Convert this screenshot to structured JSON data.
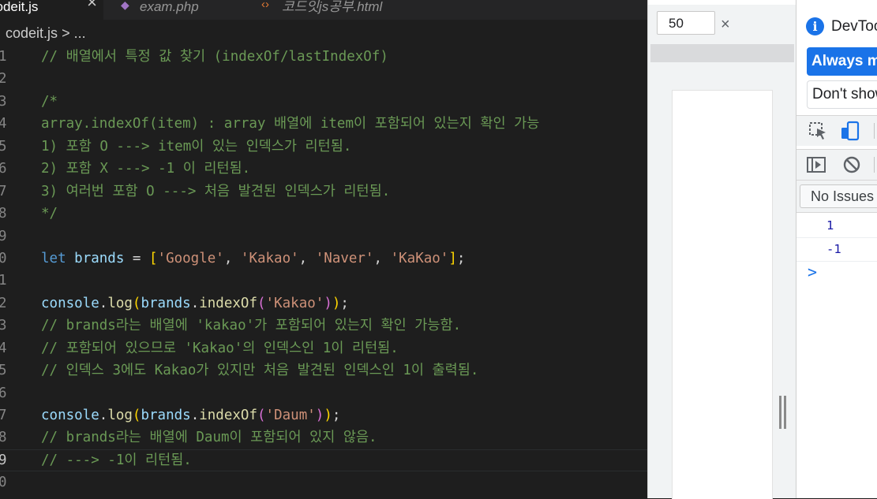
{
  "editor": {
    "tabs": [
      {
        "label": "codeit.js",
        "active": true
      },
      {
        "label": "exam.php",
        "active": false
      },
      {
        "label": "코드잇js공부.html",
        "active": false
      }
    ],
    "breadcrumb": {
      "file": "codeit.js",
      "separator": ">",
      "more": "..."
    },
    "line_numbers": [
      "1",
      "2",
      "3",
      "4",
      "5",
      "6",
      "7",
      "8",
      "9",
      "0",
      "1",
      "2",
      "3",
      "4",
      "5",
      "6",
      "7",
      "8",
      "9",
      "0"
    ],
    "current_line_index": 18,
    "code": {
      "l1": "// 배열에서 특정 값 찾기 (indexOf/lastIndexOf)",
      "l3": "/*",
      "l4": "array.indexOf(item) : array 배열에 item이 포함되어 있는지 확인 가능",
      "l5": "1) 포함 O ---> item이 있는 인덱스가 리턴됨.",
      "l6": "2) 포함 X ---> -1 이 리턴됨.",
      "l7": "3) 여러번 포함 O ---> 처음 발견된 인덱스가 리턴됨.",
      "l8": "*/",
      "l10": {
        "kw": "let",
        "name": "brands",
        "eq": " = ",
        "open": "[",
        "items": [
          "'Google'",
          "'Kakao'",
          "'Naver'",
          "'KaKao'"
        ],
        "sep": ", ",
        "close": "]",
        "end": ";"
      },
      "l12": {
        "obj": "console",
        "dot": ".",
        "method": "log",
        "open": "(",
        "arg_obj": "brands",
        "arg_method": "indexOf",
        "arg_open": "(",
        "arg": "'Kakao'",
        "arg_close": ")",
        "close": ")",
        "end": ";"
      },
      "l13": "// brands라는 배열에 'kakao'가 포함되어 있는지 확인 가능함.",
      "l14": "// 포함되어 있으므로 'Kakao'의 인덱스인 1이 리턴됨.",
      "l15": "// 인덱스 3에도 Kakao가 있지만 처음 발견된 인덱스인 1이 출력됨.",
      "l17": {
        "obj": "console",
        "dot": ".",
        "method": "log",
        "open": "(",
        "arg_obj": "brands",
        "arg_method": "indexOf",
        "arg_open": "(",
        "arg": "'Daum'",
        "arg_close": ")",
        "close": ")",
        "end": ";"
      },
      "l18": "// brands라는 배열에 Daum이 포함되어 있지 않음.",
      "l19": "// ---> -1이 리턴됨."
    }
  },
  "preview": {
    "size_value": "50",
    "clear_symbol": "×"
  },
  "devtools": {
    "title": "DevTools",
    "primary_button": "Always match",
    "secondary_button": "Don't show",
    "issues_button": "No Issues",
    "console_output": [
      "1",
      "-1"
    ],
    "prompt_symbol": ">",
    "icons": [
      "inspect-element-icon",
      "device-toggle-icon",
      "sidebar-toggle-icon",
      "clear-console-icon",
      "info-icon",
      "chevron-right-icon"
    ],
    "colors": {
      "accent": "#1a73e8",
      "console_number": "#1a1aa6"
    }
  }
}
